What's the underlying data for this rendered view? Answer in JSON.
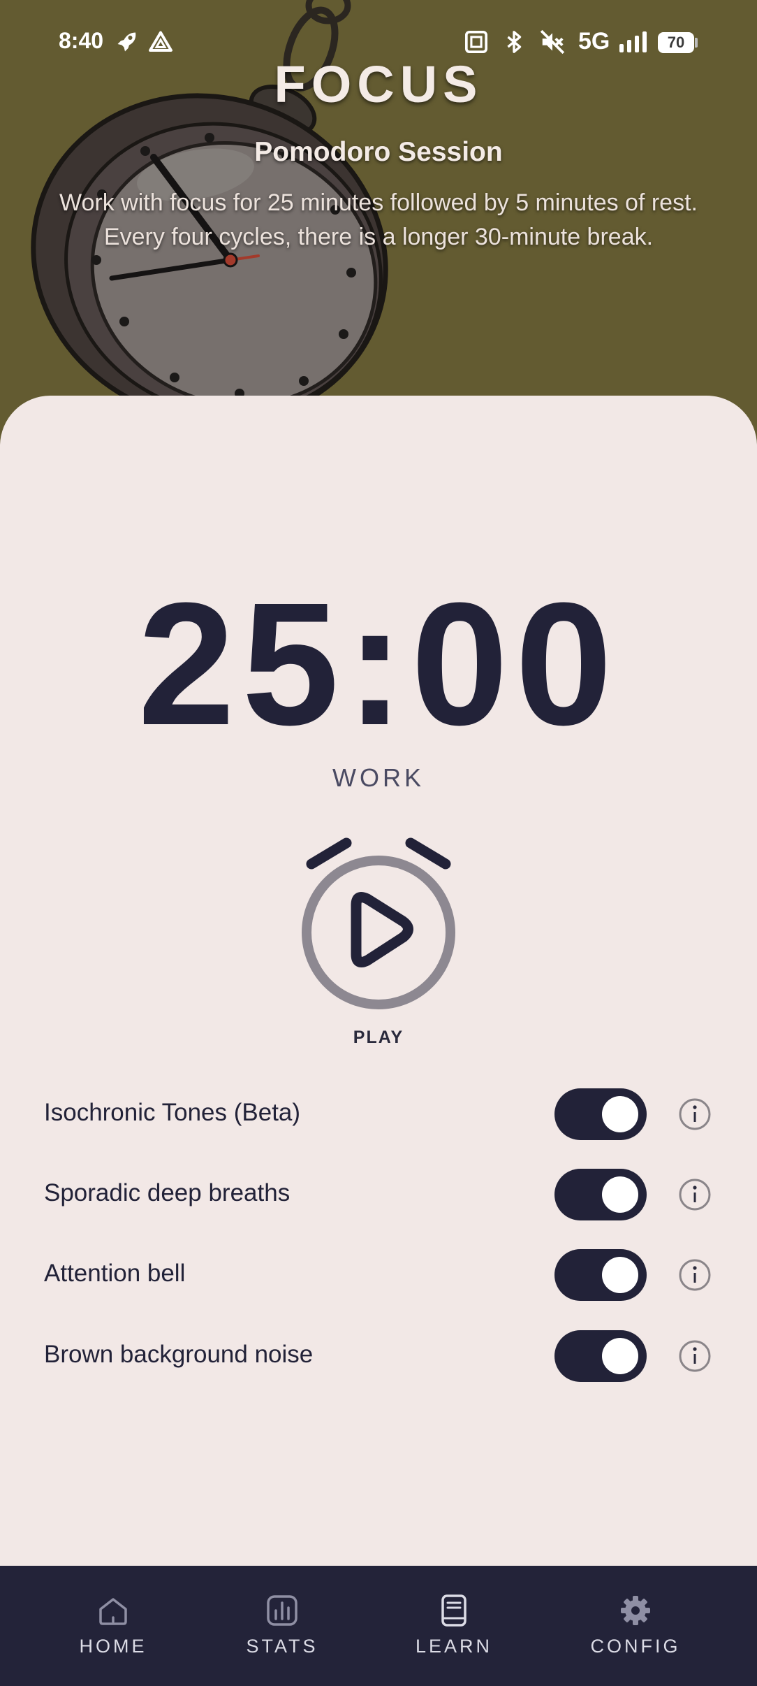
{
  "status_bar": {
    "time": "8:40",
    "network": "5G",
    "battery": "70",
    "icons": [
      "rocket-icon",
      "drive-icon",
      "nfc-icon",
      "bluetooth-icon",
      "mute-icon",
      "signal-icon",
      "battery-icon"
    ]
  },
  "hero": {
    "app_title": "FOCUS",
    "session_title": "Pomodoro Session",
    "description": "Work with focus for 25 minutes followed by 5 minutes of rest. Every four cycles, there is a longer 30-minute break.",
    "illustration": "pocket-watch-icon",
    "background_color": "#635b31"
  },
  "timer": {
    "time": "25:00",
    "phase": "WORK"
  },
  "play": {
    "label": "PLAY",
    "icon": "alarm-clock-play-icon"
  },
  "settings": [
    {
      "label": "Isochronic Tones (Beta)",
      "enabled": true
    },
    {
      "label": "Sporadic deep breaths",
      "enabled": true
    },
    {
      "label": "Attention bell",
      "enabled": true
    },
    {
      "label": "Brown background noise",
      "enabled": true
    }
  ],
  "nav": [
    {
      "label": "HOME",
      "icon": "home-icon"
    },
    {
      "label": "STATS",
      "icon": "stats-icon"
    },
    {
      "label": "LEARN",
      "icon": "book-icon"
    },
    {
      "label": "CONFIG",
      "icon": "gear-icon"
    }
  ],
  "colors": {
    "accent": "#222238",
    "card_background": "#f2e8e6",
    "nav_background": "#232339",
    "hero_background": "#635b31"
  }
}
